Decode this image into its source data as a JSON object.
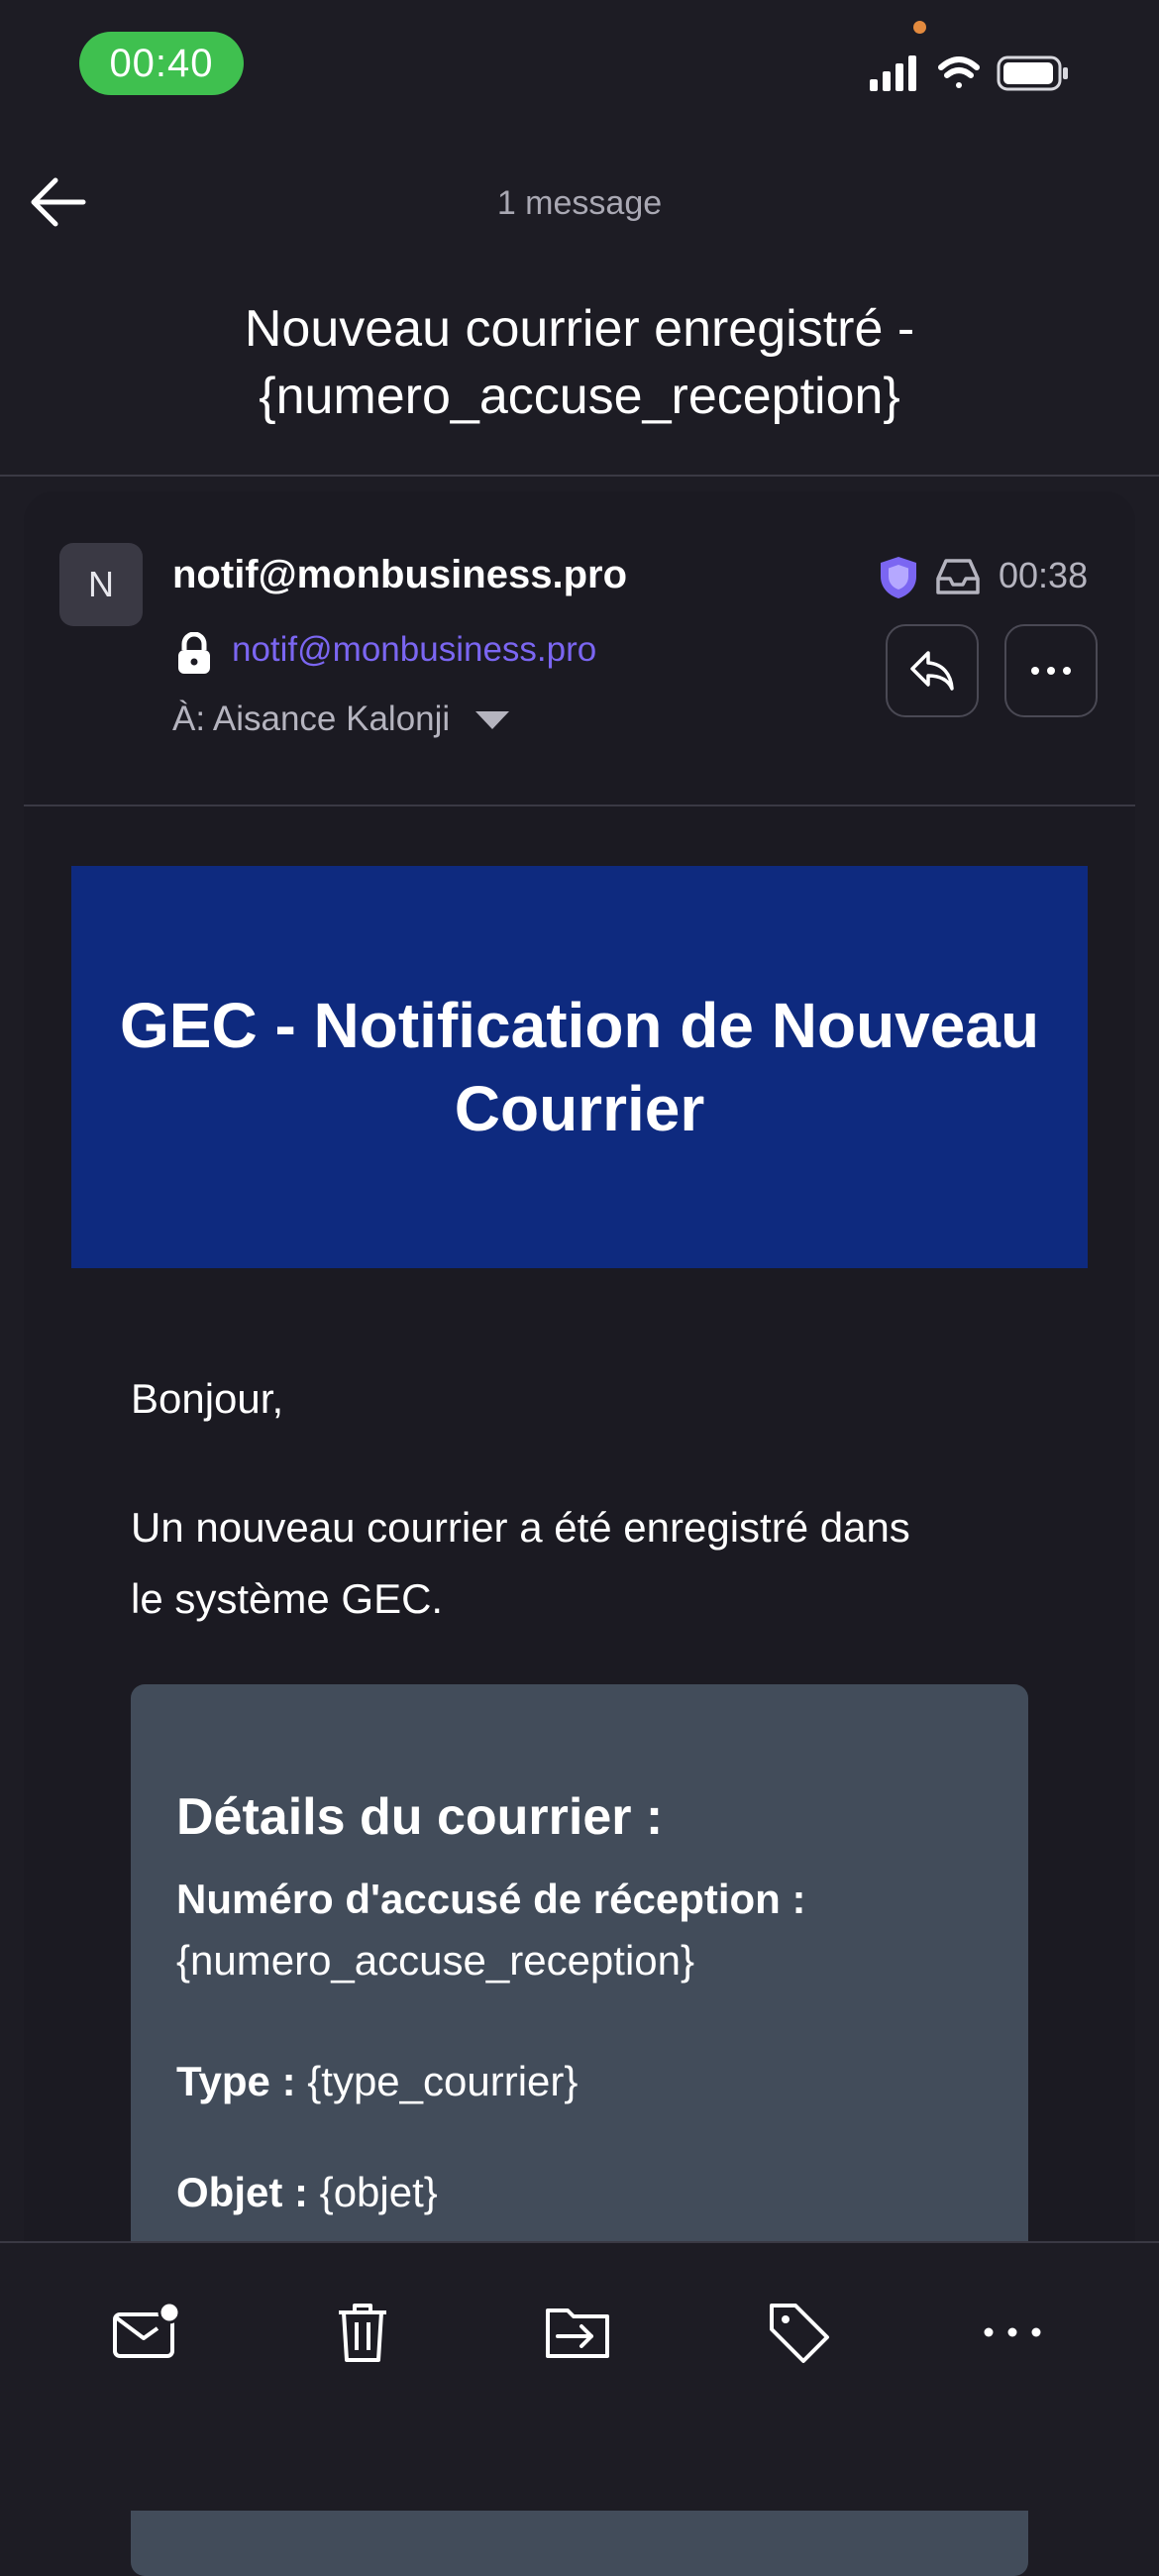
{
  "status_bar": {
    "time": "00:40"
  },
  "header": {
    "message_count": "1 message",
    "subject": "Nouveau courrier enregistré - {numero_accuse_reception}"
  },
  "email": {
    "avatar_initial": "N",
    "sender_name": "notif@monbusiness.pro",
    "sender_email": "notif@monbusiness.pro",
    "to_label": "À:",
    "to_name": "Aisance Kalonji",
    "time": "00:38",
    "accent_color": "#7b66f2",
    "banner_color": "#0e2a7f"
  },
  "body": {
    "banner_title": "GEC - Notification de Nouveau Courrier",
    "greeting": "Bonjour,",
    "intro": "Un nouveau courrier a été enregistré dans le système GEC.",
    "details": {
      "title": "Détails du courrier :",
      "rows": [
        {
          "label": "Numéro d'accusé de réception :",
          "value": "{numero_accuse_reception}"
        },
        {
          "label": "Type :",
          "value": "{type_courrier}"
        },
        {
          "label": "Objet :",
          "value": "{objet}"
        }
      ]
    }
  },
  "toolbar": {
    "icons": [
      "mark-unread-icon",
      "trash-icon",
      "move-to-folder-icon",
      "label-tag-icon",
      "more-icon"
    ]
  }
}
